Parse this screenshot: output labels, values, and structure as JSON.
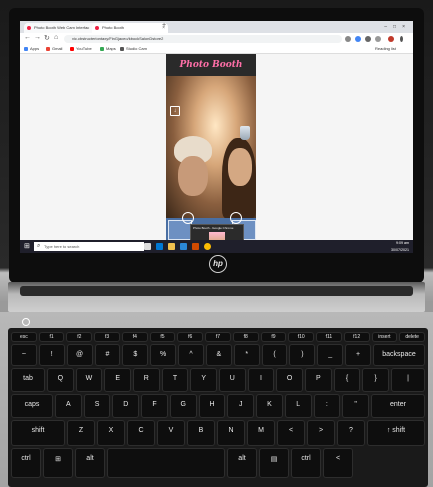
{
  "browser": {
    "tabs": [
      {
        "label": "Photo Booth Web Cam Interfac"
      },
      {
        "label": "Photo Booth"
      }
    ],
    "url": "vic.cbstructeriontaxy/FinGjaceo/kbockSalonDstore2",
    "bookmarks": [
      "Apps",
      "Gmail",
      "YouTube",
      "Maps",
      "Studio Cam"
    ],
    "reading_list": "Reading list",
    "accent_color": "#e24a6b"
  },
  "photobooth": {
    "title": "Photo Booth",
    "title_color": "#ff6fa8",
    "popup_title": "Photo Booth - Google Chrome"
  },
  "taskbar": {
    "search_placeholder": "Type here to search",
    "time": "9:09 am",
    "date": "30/07/2021"
  },
  "laptop": {
    "brand": "hp"
  },
  "keyboard": {
    "row_fn": [
      "esc",
      "f1",
      "f2",
      "f3",
      "f4",
      "f5",
      "f6",
      "f7",
      "f8",
      "f9",
      "f10",
      "f11",
      "f12",
      "insert",
      "delete"
    ],
    "row_num": [
      "~",
      "!",
      "@",
      "#",
      "$",
      "%",
      "^",
      "&",
      "*",
      "(",
      ")",
      "_",
      "+",
      "backspace"
    ],
    "row_q": [
      "tab",
      "Q",
      "W",
      "E",
      "R",
      "T",
      "Y",
      "U",
      "I",
      "O",
      "P",
      "{",
      "}",
      "|"
    ],
    "row_a": [
      "caps",
      "A",
      "S",
      "D",
      "F",
      "G",
      "H",
      "J",
      "K",
      "L",
      ":",
      "\"",
      "enter"
    ],
    "row_z": [
      "shift",
      "Z",
      "X",
      "C",
      "V",
      "B",
      "N",
      "M",
      "<",
      ">",
      "?",
      "↑ shift"
    ],
    "row_bottom": [
      "ctrl",
      "⊞",
      "alt",
      "",
      "alt",
      "▤",
      "ctrl",
      "<"
    ]
  }
}
